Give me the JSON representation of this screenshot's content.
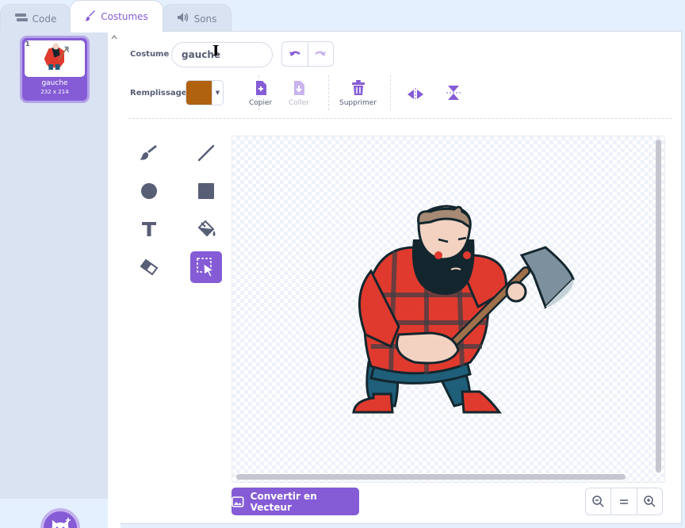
{
  "tabs": [
    {
      "label": "Code",
      "icon": "code-icon"
    },
    {
      "label": "Costumes",
      "icon": "brush-icon"
    },
    {
      "label": "Sons",
      "icon": "speaker-icon"
    }
  ],
  "costume_list": [
    {
      "number": "1",
      "name": "gauche",
      "size": "232 x 214"
    }
  ],
  "editor": {
    "costume_label": "Costume",
    "costume_name": "gauche",
    "fill_label": "Remplissage",
    "fill_color": "#b0620f",
    "copy_label": "Copier",
    "paste_label": "Coller",
    "delete_label": "Supprimer",
    "convert_label": "Convertir en Vecteur"
  },
  "colors": {
    "accent": "#855cd6",
    "tab_inactive": "#d9e3f2",
    "background": "#e5f0ff"
  },
  "tools": [
    "brush-icon",
    "line-icon",
    "circle-icon",
    "rectangle-icon",
    "text-icon",
    "fill-icon",
    "eraser-icon",
    "select-icon"
  ],
  "zoom_controls": [
    "zoom-out-icon",
    "zoom-reset-icon",
    "zoom-in-icon"
  ]
}
